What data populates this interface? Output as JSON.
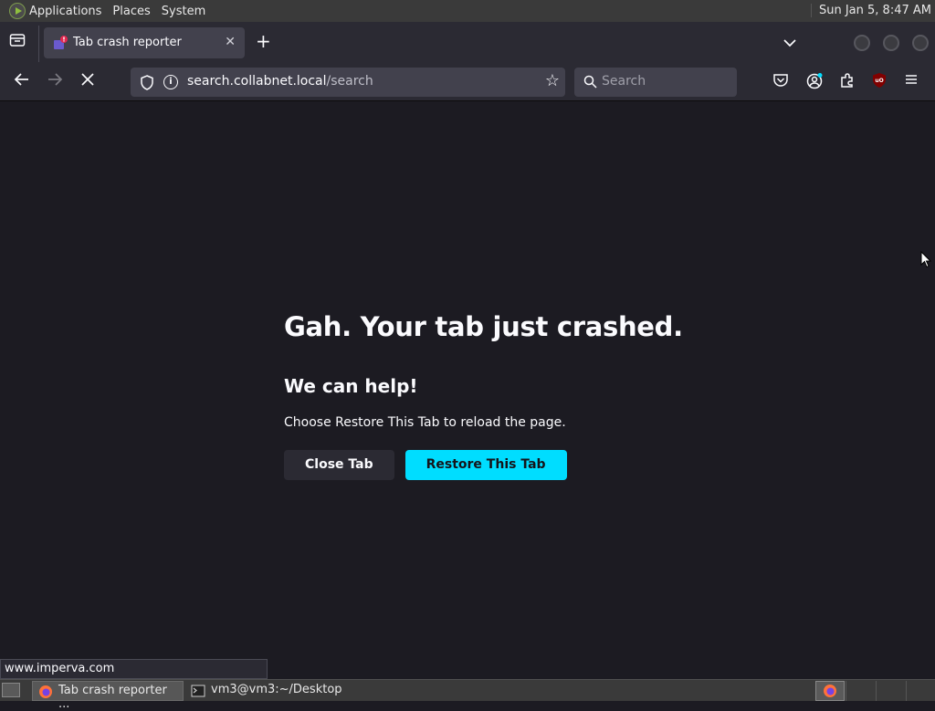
{
  "system_panel": {
    "menus": [
      "Applications",
      "Places",
      "System"
    ],
    "clock": "Sun Jan  5,  8:47 AM"
  },
  "tabs": [
    {
      "title": "Tab crash reporter",
      "active": true
    }
  ],
  "navbar": {
    "url_host": "search.collabnet.local",
    "url_path": "/search",
    "search_placeholder": "Search"
  },
  "crash_page": {
    "title": "Gah. Your tab just crashed.",
    "subtitle": "We can help!",
    "message": "Choose Restore This Tab to reload the page.",
    "close_label": "Close Tab",
    "restore_label": "Restore This Tab"
  },
  "status_text": "www.imperva.com",
  "taskbar": {
    "tasks": [
      {
        "label": "Tab crash reporter ...",
        "icon": "firefox-icon",
        "active": true
      },
      {
        "label": "vm3@vm3:~/Desktop",
        "icon": "terminal-icon",
        "active": false
      }
    ]
  },
  "colors": {
    "page_bg": "#1c1b22",
    "chrome_bg": "#2b2a33",
    "primary_button": "#00ddff"
  }
}
